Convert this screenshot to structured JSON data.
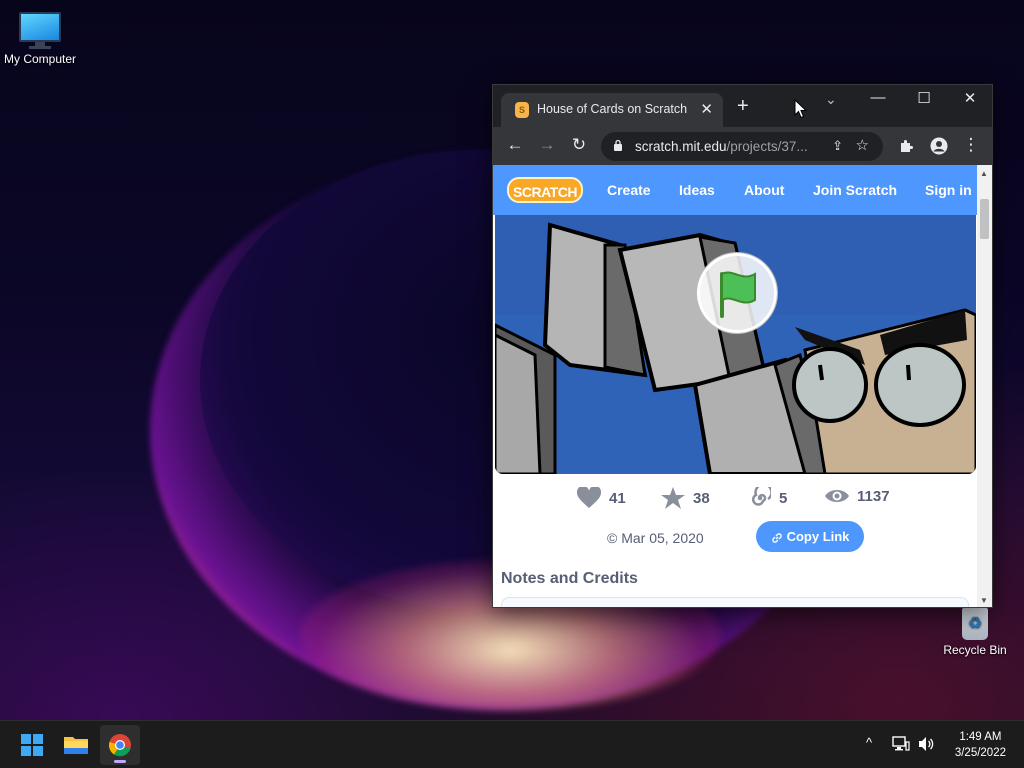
{
  "desktop": {
    "icons": [
      {
        "label": "My Computer"
      },
      {
        "label": "Recycle Bin"
      }
    ]
  },
  "browser": {
    "tab": {
      "title": "House of Cards on Scratch",
      "close_glyph": "✕"
    },
    "new_tab_glyph": "+",
    "tab_search_glyph": "⌄",
    "window_controls": {
      "minimize": "—",
      "maximize": "☐",
      "close": "✕"
    },
    "toolbar": {
      "back_glyph": "←",
      "forward_glyph": "→",
      "reload_glyph": "↻",
      "url_host": "scratch.mit.edu",
      "url_path": "/projects/37...",
      "share_glyph": "⇪",
      "bookmark_glyph": "☆",
      "menu_glyph": "⋮"
    }
  },
  "scratch": {
    "logo": "SCRATCH",
    "nav": [
      "Create",
      "Ideas",
      "About",
      "Join Scratch",
      "Sign in"
    ],
    "stats": {
      "loves": "41",
      "favorites": "38",
      "remixes": "5",
      "views": "1137"
    },
    "date": "© Mar 05, 2020",
    "copy_link": "Copy Link",
    "notes_heading": "Notes and Credits"
  },
  "taskbar": {
    "time": "1:49 AM",
    "date": "3/25/2022",
    "tray_chevron": "^"
  },
  "colors": {
    "scratch_blue": "#4d97ff",
    "chrome_dark": "#202124",
    "chrome_tab": "#35363a",
    "text_muted": "#575e75"
  }
}
